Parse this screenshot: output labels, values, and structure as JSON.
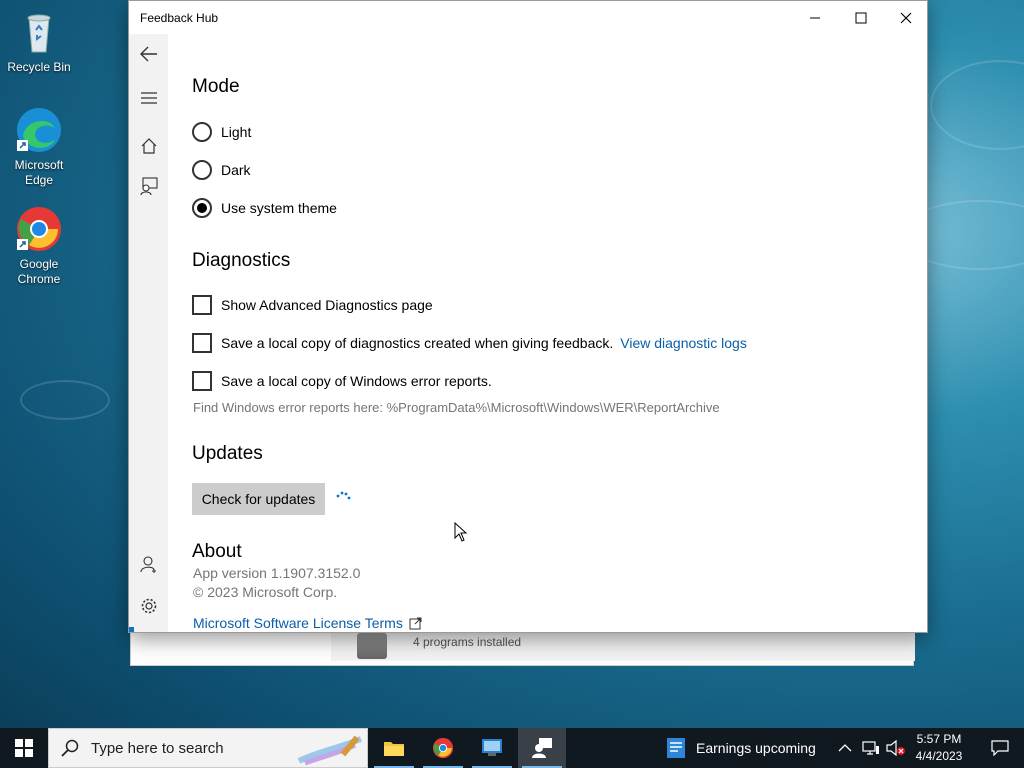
{
  "desktop": {
    "icons": [
      {
        "label": "Recycle Bin"
      },
      {
        "label": "Microsoft Edge"
      },
      {
        "label": "Google Chrome"
      }
    ]
  },
  "background_window": {
    "text": "4 programs installed"
  },
  "window": {
    "title": "Feedback Hub",
    "mode": {
      "heading": "Mode",
      "options": [
        "Light",
        "Dark",
        "Use system theme"
      ],
      "selected": "Use system theme"
    },
    "diagnostics": {
      "heading": "Diagnostics",
      "show_advanced": "Show Advanced Diagnostics page",
      "save_local": "Save a local copy of diagnostics created when giving feedback.",
      "view_logs_link": "View diagnostic logs",
      "save_errors": "Save a local copy of Windows error reports.",
      "find_reports": "Find Windows error reports here: %ProgramData%\\Microsoft\\Windows\\WER\\ReportArchive"
    },
    "updates": {
      "heading": "Updates",
      "check_button": "Check for updates"
    },
    "about": {
      "heading": "About",
      "version": "App version 1.1907.3152.0",
      "copyright": "© 2023 Microsoft Corp.",
      "license_link": "Microsoft Software License Terms"
    }
  },
  "taskbar": {
    "search_placeholder": "Type here to search",
    "news": "Earnings upcoming",
    "time": "5:57 PM",
    "date": "4/4/2023"
  },
  "colors": {
    "accent": "#0a74c9",
    "link": "#0a5ea8",
    "taskbar": "#101820"
  }
}
